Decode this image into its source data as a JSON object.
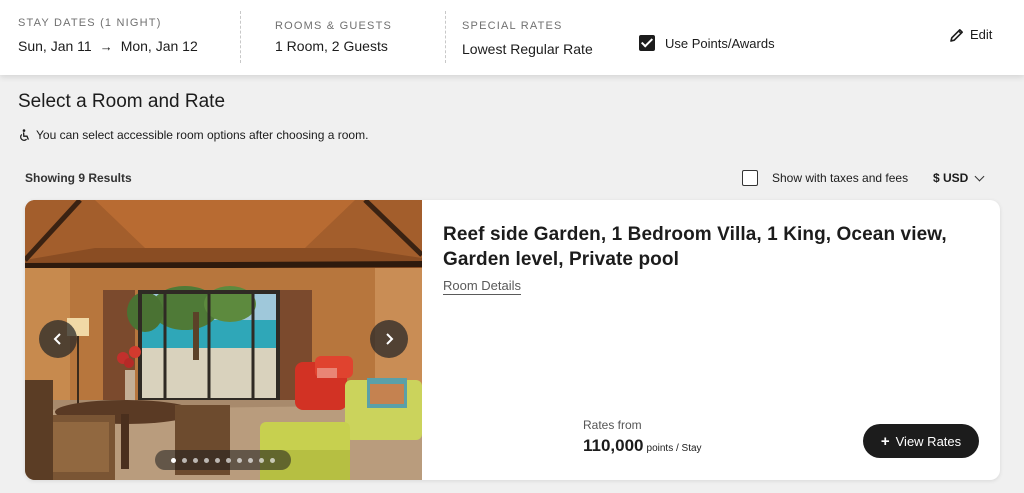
{
  "search_bar": {
    "stay_dates_label": "STAY DATES (1 NIGHT)",
    "check_in": "Sun, Jan 11",
    "check_out": "Mon, Jan 12",
    "rooms_guests_label": "ROOMS & GUESTS",
    "rooms_guests_value": "1 Room, 2 Guests",
    "special_rates_label": "SPECIAL RATES",
    "special_rates_value": "Lowest Regular Rate",
    "use_points_label": "Use Points/Awards",
    "use_points_checked": true,
    "edit_label": "Edit"
  },
  "page": {
    "title": "Select a Room and Rate",
    "accessibility_note": "You can select accessible room options after choosing a room.",
    "results_label": "Showing 9 Results",
    "taxes_label": "Show with taxes and fees",
    "taxes_checked": false,
    "currency": "$ USD"
  },
  "room_card": {
    "name": "Reef side Garden, 1 Bedroom Villa, 1 King, Ocean view, Garden level, Private pool",
    "details_link": "Room Details",
    "rates_from_label": "Rates from",
    "price": "110,000",
    "price_unit": "points / Stay",
    "view_rates_label": "View Rates",
    "photo_count": 10,
    "active_photo": 0
  },
  "colors": {
    "primary_dark": "#1c1c1c",
    "background": "#f0f0f0",
    "card": "#ffffff"
  }
}
